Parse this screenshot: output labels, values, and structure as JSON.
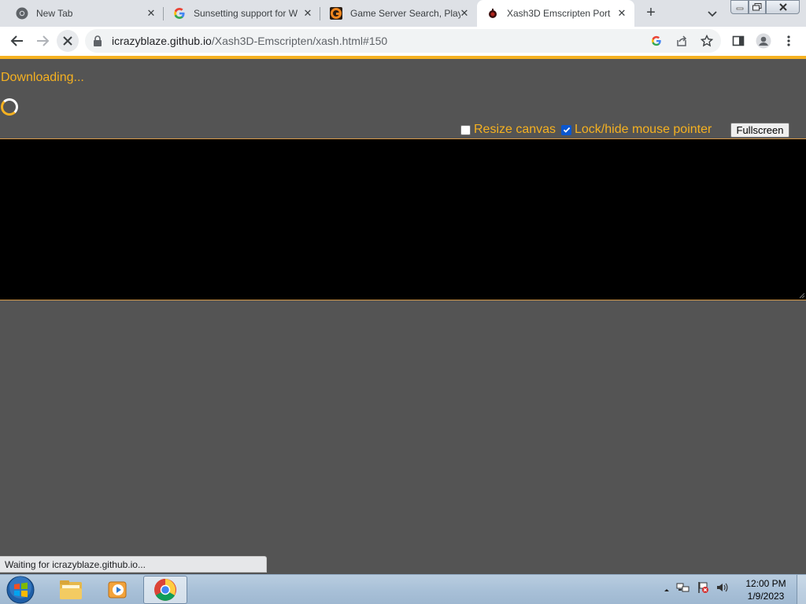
{
  "tabs": [
    {
      "title": "New Tab",
      "icon": "chrome-icon"
    },
    {
      "title": "Sunsetting support for W",
      "icon": "google-icon"
    },
    {
      "title": "Game Server Search, Play",
      "icon": "gametracker-icon"
    },
    {
      "title": "Xash3D Emscripten Port",
      "icon": "xash-icon",
      "active": true
    }
  ],
  "close_glyph": "✕",
  "new_tab_glyph": "+",
  "address_bar": {
    "host": "icrazyblaze.github.io",
    "path": "/Xash3D-Emscripten/xash.html#150"
  },
  "page": {
    "status": "Downloading...",
    "resize_canvas_label": "Resize canvas",
    "resize_canvas_checked": false,
    "lock_pointer_label": "Lock/hide mouse pointer",
    "lock_pointer_checked": true,
    "fullscreen_label": "Fullscreen",
    "accent_color": "#f5b121",
    "background_color": "#545454"
  },
  "status_bubble": "Waiting for icrazyblaze.github.io...",
  "taskbar": {
    "time": "12:00 PM",
    "date": "1/9/2023"
  }
}
